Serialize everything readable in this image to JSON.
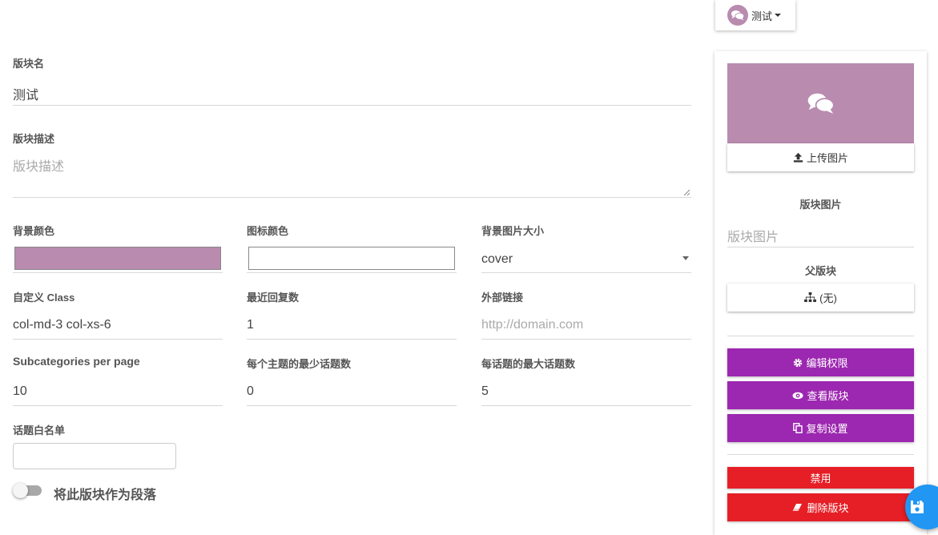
{
  "user_menu": {
    "name": "测试",
    "avatar_icon": "comments-icon",
    "avatar_color": "#b98baf"
  },
  "form": {
    "name": {
      "label": "版块名",
      "value": "测试"
    },
    "description": {
      "label": "版块描述",
      "placeholder": "版块描述"
    },
    "bg_color": {
      "label": "背景颜色",
      "value": "#b98baf"
    },
    "icon_color": {
      "label": "图标颜色",
      "value": "#ffffff"
    },
    "bg_image_size": {
      "label": "背景图片大小",
      "value": "cover"
    },
    "custom_class": {
      "label": "自定义 Class",
      "value": "col-md-3 col-xs-6"
    },
    "recent_replies": {
      "label": "最近回复数",
      "value": "1"
    },
    "external_link": {
      "label": "外部链接",
      "placeholder": "http://domain.com"
    },
    "subcategories_per_page": {
      "label": "Subcategories per page",
      "value": "10"
    },
    "min_tags": {
      "label": "每个主题的最少话题数",
      "value": "0"
    },
    "max_tags": {
      "label": "每话题的最大话题数",
      "value": "5"
    },
    "tag_whitelist": {
      "label": "话题白名单",
      "value": ""
    },
    "section_toggle": {
      "label": "将此版块作为段落",
      "checked": false
    }
  },
  "panel": {
    "preview_icon": "comments-icon",
    "upload_label": "上传图片",
    "image_label": "版块图片",
    "image_placeholder": "版块图片",
    "parent_label": "父版块",
    "parent_value": "(无)",
    "edit_perms": "编辑权限",
    "view_category": "查看版块",
    "copy_settings": "复制设置",
    "disable": "禁用",
    "delete": "删除版块",
    "purple": "#9c27b0",
    "red": "#e61f26"
  },
  "fab_icon": "save-icon"
}
